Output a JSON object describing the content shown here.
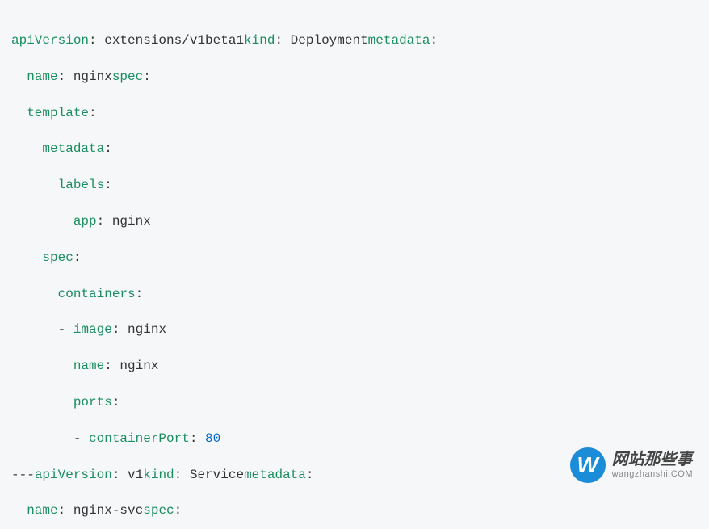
{
  "code": {
    "lines": [
      {
        "indent": 0,
        "segments": [
          {
            "type": "key",
            "text": "apiVersion"
          },
          {
            "type": "colon",
            "text": ": "
          },
          {
            "type": "value-text",
            "text": "extensions/v1beta1"
          },
          {
            "type": "key",
            "text": "kind"
          },
          {
            "type": "colon",
            "text": ": "
          },
          {
            "type": "value-text",
            "text": "Deployment"
          },
          {
            "type": "key",
            "text": "metadata"
          },
          {
            "type": "colon",
            "text": ":"
          }
        ]
      },
      {
        "indent": 2,
        "segments": [
          {
            "type": "key",
            "text": "name"
          },
          {
            "type": "colon",
            "text": ": "
          },
          {
            "type": "value-text",
            "text": "nginx"
          },
          {
            "type": "key",
            "text": "spec"
          },
          {
            "type": "colon",
            "text": ":"
          }
        ]
      },
      {
        "indent": 2,
        "segments": [
          {
            "type": "key",
            "text": "template"
          },
          {
            "type": "colon",
            "text": ":"
          }
        ]
      },
      {
        "indent": 4,
        "segments": [
          {
            "type": "key",
            "text": "metadata"
          },
          {
            "type": "colon",
            "text": ":"
          }
        ]
      },
      {
        "indent": 6,
        "segments": [
          {
            "type": "key",
            "text": "labels"
          },
          {
            "type": "colon",
            "text": ":"
          }
        ]
      },
      {
        "indent": 8,
        "segments": [
          {
            "type": "key",
            "text": "app"
          },
          {
            "type": "colon",
            "text": ": "
          },
          {
            "type": "value-text",
            "text": "nginx"
          }
        ]
      },
      {
        "indent": 4,
        "segments": [
          {
            "type": "key",
            "text": "spec"
          },
          {
            "type": "colon",
            "text": ":"
          }
        ]
      },
      {
        "indent": 6,
        "segments": [
          {
            "type": "key",
            "text": "containers"
          },
          {
            "type": "colon",
            "text": ":"
          }
        ]
      },
      {
        "indent": 6,
        "segments": [
          {
            "type": "separator",
            "text": "- "
          },
          {
            "type": "key",
            "text": "image"
          },
          {
            "type": "colon",
            "text": ": "
          },
          {
            "type": "value-text",
            "text": "nginx"
          }
        ]
      },
      {
        "indent": 8,
        "segments": [
          {
            "type": "key",
            "text": "name"
          },
          {
            "type": "colon",
            "text": ": "
          },
          {
            "type": "value-text",
            "text": "nginx"
          }
        ]
      },
      {
        "indent": 8,
        "segments": [
          {
            "type": "key",
            "text": "ports"
          },
          {
            "type": "colon",
            "text": ":"
          }
        ]
      },
      {
        "indent": 8,
        "segments": [
          {
            "type": "separator",
            "text": "- "
          },
          {
            "type": "key",
            "text": "containerPort"
          },
          {
            "type": "colon",
            "text": ": "
          },
          {
            "type": "value-number",
            "text": "80"
          }
        ]
      },
      {
        "indent": 0,
        "segments": [
          {
            "type": "separator",
            "text": "---"
          },
          {
            "type": "key",
            "text": "apiVersion"
          },
          {
            "type": "colon",
            "text": ": "
          },
          {
            "type": "value-text",
            "text": "v1"
          },
          {
            "type": "key",
            "text": "kind"
          },
          {
            "type": "colon",
            "text": ": "
          },
          {
            "type": "value-text",
            "text": "Service"
          },
          {
            "type": "key",
            "text": "metadata"
          },
          {
            "type": "colon",
            "text": ":"
          }
        ]
      },
      {
        "indent": 2,
        "segments": [
          {
            "type": "key",
            "text": "name"
          },
          {
            "type": "colon",
            "text": ": "
          },
          {
            "type": "value-text",
            "text": "nginx-svc"
          },
          {
            "type": "key",
            "text": "spec"
          },
          {
            "type": "colon",
            "text": ":"
          }
        ]
      }
    ]
  },
  "watermark": {
    "icon_letter": "W",
    "chinese": "网站那些事",
    "english": "wangzhanshi.COM"
  }
}
